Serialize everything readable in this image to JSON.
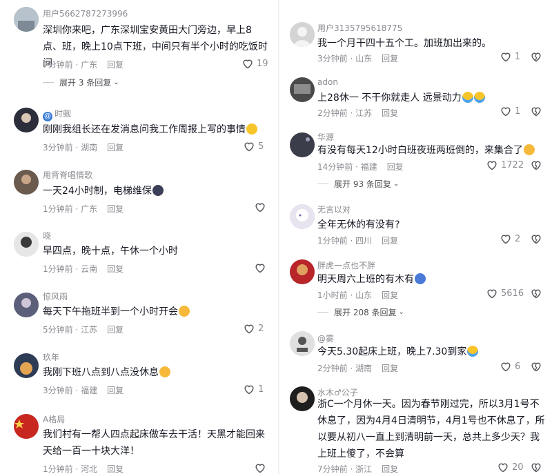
{
  "left": {
    "comments": [
      {
        "user": "用户5662787273996",
        "text": "深圳你来吧，广东深圳宝安黄田大门旁边，早上8点、班，晚上10点下班，中间只有半个小时的吃饭时间",
        "time_loc": "7分钟前 · 广东",
        "reply": "回复",
        "likes": "19",
        "expand": "展开 3 条回复",
        "avatar_color": "#9aa6b2"
      },
      {
        "user": "时觋",
        "text": "刚刚我组长还在发消息问我工作周报上写的事情",
        "time_loc": "3分钟前 · 湖南",
        "reply": "回复",
        "likes": "5",
        "avatar_color": "#2c2f3a"
      },
      {
        "user": "用背脊唱情歌",
        "text": "一天24小时制，电梯维保",
        "time_loc": "1分钟前 · 广东",
        "reply": "回复",
        "likes": "",
        "avatar_color": "#6b5a4e"
      },
      {
        "user": "晓",
        "text": "早四点，晚十点，午休一个小时",
        "time_loc": "1分钟前 · 云南",
        "reply": "回复",
        "likes": "",
        "avatar_color": "#3a3a3a"
      },
      {
        "user": "惊风雨",
        "text": "每天下午拖班半到一个小时开会",
        "time_loc": "5分钟前 · 江苏",
        "reply": "回复",
        "likes": "2",
        "avatar_color": "#5b5f7a"
      },
      {
        "user": "玖年",
        "text": "我刚下班八点到八点没休息",
        "time_loc": "3分钟前 · 福建",
        "reply": "回复",
        "likes": "1",
        "avatar_color": "#2d3b55"
      },
      {
        "user": "A格局",
        "text": "我们村有一帮人四点起床做车去干活！天黑才能回来天给一百一十块大洋！",
        "time_loc": "1分钟前 · 河北",
        "reply": "回复",
        "likes": "",
        "avatar_color": "#c8271f"
      }
    ]
  },
  "right": {
    "comments": [
      {
        "user": "用户3135795618775",
        "text": "我一个月干四十五个工。加班加出来的。",
        "time_loc": "3分钟前 · 山东",
        "reply": "回复",
        "likes": "1",
        "avatar_color": "#c9c9c9"
      },
      {
        "user": "adon",
        "text": "上28休一 不干你就走人 远景动力",
        "time_loc": "2分钟前 · 江苏",
        "reply": "回复",
        "likes": "1",
        "avatar_color": "#4a4a4a"
      },
      {
        "user": "华源",
        "text": "有没有每天12小时白班夜班两班倒的，来集合了",
        "time_loc": "14分钟前 · 福建",
        "reply": "回复",
        "likes": "1722",
        "expand": "展开 93 条回复",
        "avatar_color": "#3b3d4a"
      },
      {
        "user": "无言以对",
        "text": "全年无休的有没有?",
        "time_loc": "1分钟前 · 四川",
        "reply": "回复",
        "likes": "2",
        "avatar_color": "#e8e4ef"
      },
      {
        "user": "胖虎一点也不胖",
        "text": "明天周六上班的有木有",
        "time_loc": "1小时前 · 山东",
        "reply": "回复",
        "likes": "5616",
        "expand": "展开 208 条回复",
        "avatar_color": "#b8262a"
      },
      {
        "user": "@雾",
        "text": "今天5.30起床上班，晚上7.30到家",
        "time_loc": "2分钟前 · 湖南",
        "reply": "回复",
        "likes": "6",
        "avatar_color": "#e0e0e0"
      },
      {
        "user": "水木♂公子",
        "text": "浙C一个月休一天。因为春节刚过完，所以3月1号不休息了，因为4月4日清明节，4月1号也不休息了，所以要从初八一直上到清明前一天，总共上多少天？我上班上傻了，不会算",
        "time_loc": "7分钟前 · 浙江",
        "reply": "回复",
        "likes": "20",
        "avatar_color": "#1e1e1e"
      }
    ]
  },
  "icons": {
    "like": "heart-outline-icon",
    "dislike": "broken-heart-icon",
    "chevron": "chevron-down-icon"
  }
}
